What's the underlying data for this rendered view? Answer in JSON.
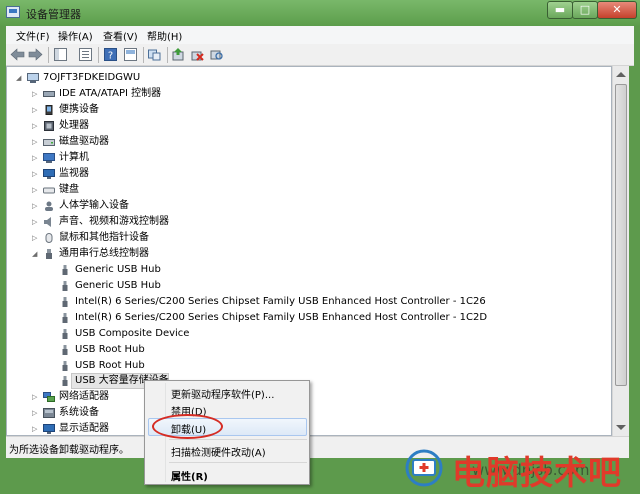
{
  "window": {
    "title": "设备管理器",
    "controls": [
      "minimize",
      "maximize",
      "close"
    ]
  },
  "menubar": {
    "items": [
      "文件(F)",
      "操作(A)",
      "查看(V)",
      "帮助(H)"
    ]
  },
  "toolbar": {
    "icons": [
      "back-icon",
      "forward-icon",
      "console-tree-icon",
      "properties-icon",
      "help-icon",
      "show-hide-icon",
      "view-icon",
      "update-driver-icon",
      "uninstall-icon",
      "scan-hardware-icon"
    ]
  },
  "tree": {
    "root": "7OJFT3FDKEIDGWU",
    "categories": [
      "IDE ATA/ATAPI 控制器",
      "便携设备",
      "处理器",
      "磁盘驱动器",
      "计算机",
      "监视器",
      "键盘",
      "人体学输入设备",
      "声音、视频和游戏控制器",
      "鼠标和其他指针设备",
      "通用串行总线控制器"
    ],
    "usb_children": [
      "Generic USB Hub",
      "Generic USB Hub",
      "Intel(R) 6 Series/C200 Series Chipset Family USB Enhanced Host Controller - 1C26",
      "Intel(R) 6 Series/C200 Series Chipset Family USB Enhanced Host Controller - 1C2D",
      "USB Composite Device",
      "USB Root Hub",
      "USB Root Hub",
      "USB 大容量存储设备"
    ],
    "after_categories": [
      "网络适配器",
      "系统设备",
      "显示适配器"
    ]
  },
  "context_menu": {
    "items": [
      "更新驱动程序软件(P)...",
      "禁用(D)",
      "卸载(U)",
      "扫描检测硬件改动(A)",
      "属性(R)"
    ],
    "highlighted": "卸载(U)"
  },
  "status": {
    "text": "为所选设备卸载驱动程序。"
  },
  "watermark": {
    "text": "电脑技术吧",
    "sub": "www.dnjsb.com"
  },
  "colors": {
    "title_bar": "#6aab59",
    "accent_red": "#e03a2a",
    "highlight_border": "#a9c7ef"
  }
}
